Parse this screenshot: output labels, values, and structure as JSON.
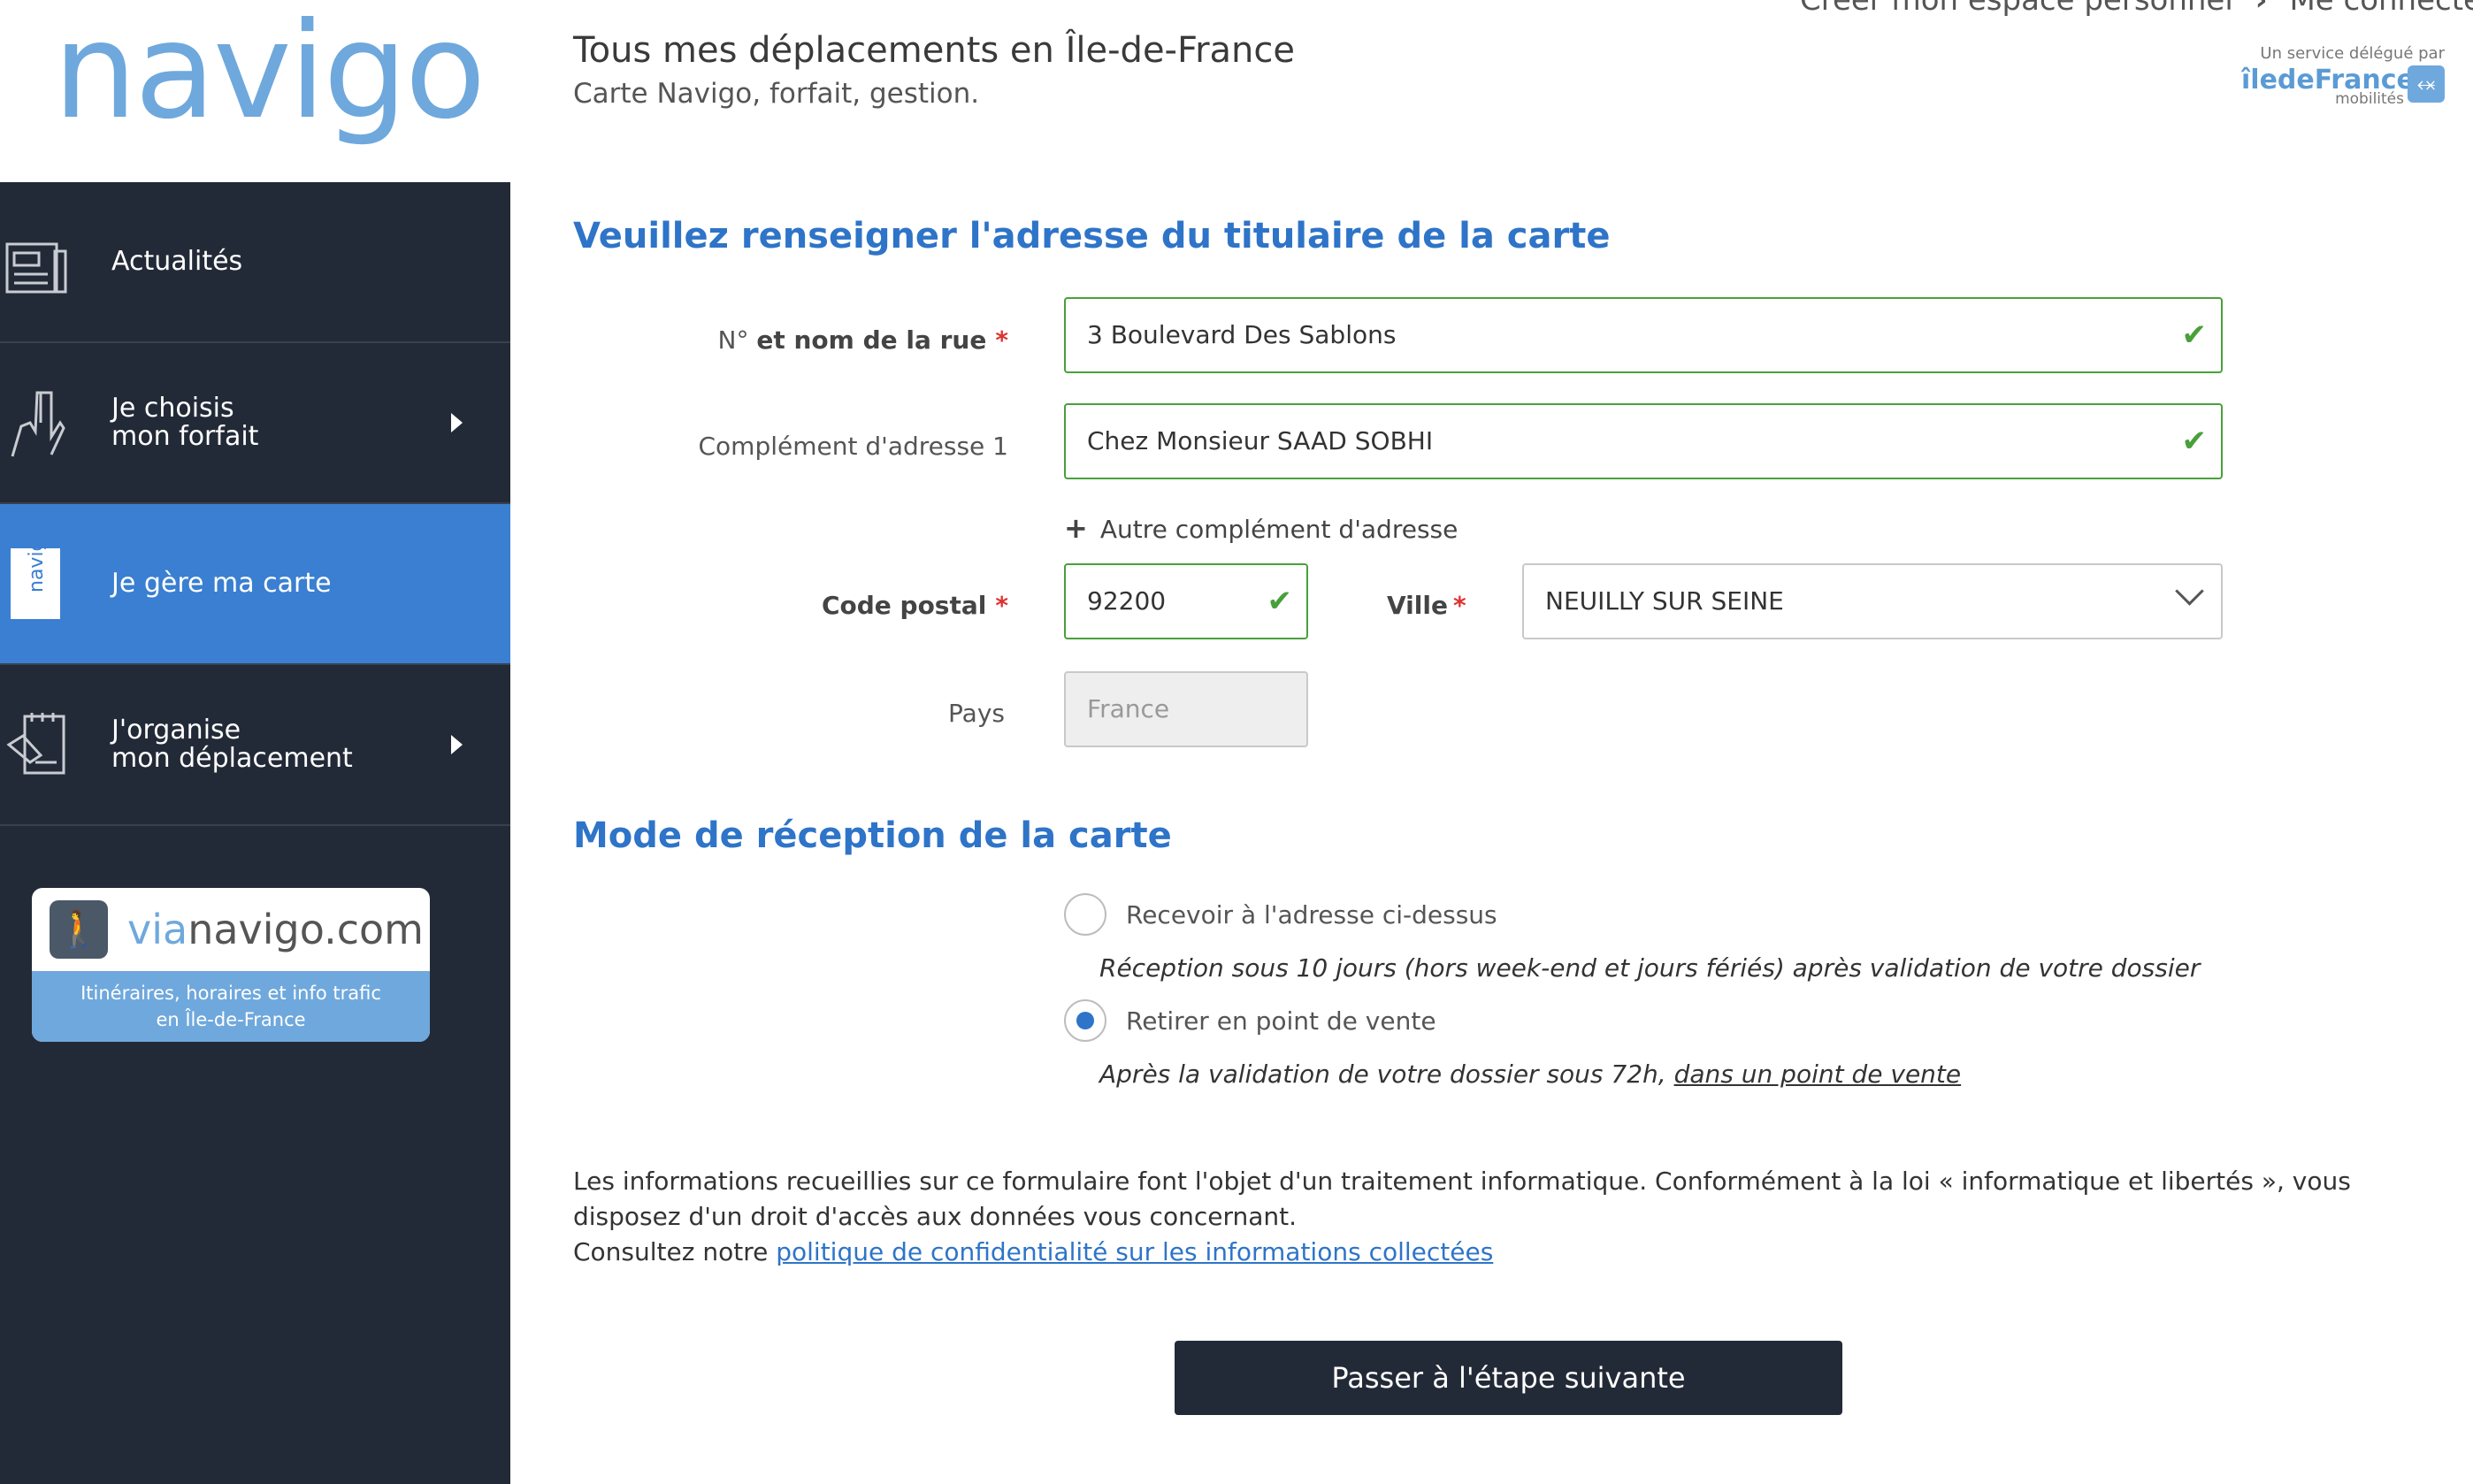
{
  "header": {
    "logo_text": "navigo",
    "title": "Tous mes déplacements en Île-de-France",
    "subtitle": "Carte Navigo, forfait, gestion.",
    "link_create": "Créer mon espace personnel",
    "link_login": "Me connecter",
    "partner_line": "Un service délégué par",
    "partner_name": "îledeFrance",
    "partner_sub": "mobilités"
  },
  "sidebar": {
    "items": [
      {
        "label": "Actualités",
        "icon": "newspaper-icon"
      },
      {
        "label": "Je choisis mon forfait",
        "line1": "Je choisis",
        "line2": "mon forfait",
        "icon": "hand-icon"
      },
      {
        "label": "Je gère ma carte",
        "icon": "card-icon",
        "active": true
      },
      {
        "label": "J'organise mon déplacement",
        "line1": "J'organise",
        "line2": "mon déplacement",
        "icon": "notepad-icon"
      }
    ],
    "promo": {
      "brand_via": "via",
      "brand_rest": "navigo.com",
      "desc_line1": "Itinéraires, horaires et info trafic",
      "desc_line2": "en Île-de-France"
    }
  },
  "form": {
    "heading_address": "Veuillez renseigner l'adresse du titulaire de la carte",
    "street_label_prefix": "N°",
    "street_label_bold": "et nom de la rue",
    "street_value": "3 Boulevard Des Sablons",
    "complement_label": "Complément d'adresse 1",
    "complement_value": "Chez Monsieur SAAD SOBHI",
    "add_complement": "Autre complément d'adresse",
    "postal_label": "Code postal",
    "postal_value": "92200",
    "city_label": "Ville",
    "city_value": "NEUILLY SUR SEINE",
    "country_label": "Pays",
    "country_value": "France",
    "required_mark": "*"
  },
  "reception": {
    "heading": "Mode de réception de la carte",
    "option1_label": "Recevoir à l'adresse ci-dessus",
    "option1_note": "Réception sous 10 jours (hors week-end et jours fériés) après validation de votre dossier",
    "option2_label": "Retirer en point de vente",
    "option2_note_prefix": "Après la validation de votre dossier sous 72h,",
    "option2_note_link": "dans un point de vente",
    "selected": 2
  },
  "legal": {
    "text": "Les informations recueillies sur ce formulaire font l'objet d'un traitement informatique. Conformément à la loi « informatique et libertés », vous disposez d'un droit d'accès aux données vous concernant.",
    "consult_prefix": "Consultez notre",
    "policy_link": "politique de confidentialité sur les informations collectées"
  },
  "actions": {
    "next_label": "Passer à l'étape suivante"
  },
  "colors": {
    "brand_blue": "#2e74c8",
    "sidebar_bg": "#232a37",
    "active_bg": "#3a7fd1",
    "valid_green": "#49a03b"
  }
}
